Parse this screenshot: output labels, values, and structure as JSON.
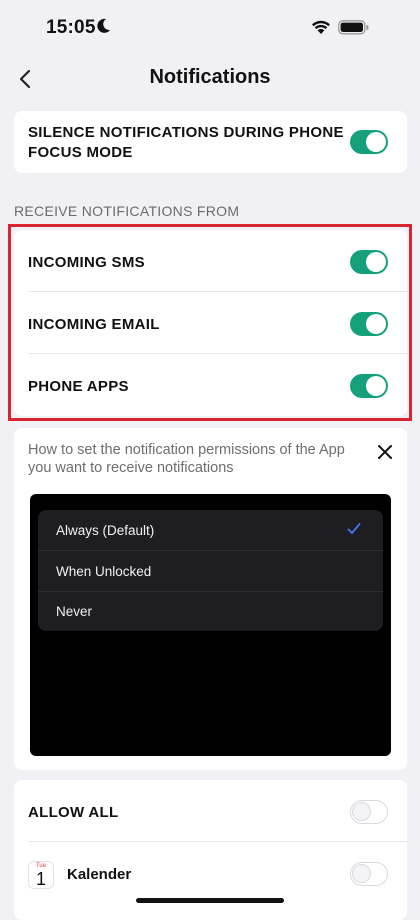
{
  "status_bar": {
    "time": "15:05",
    "icons": [
      "moon-icon",
      "wifi-icon",
      "battery-icon"
    ]
  },
  "nav": {
    "title": "Notifications",
    "back_icon": "chevron-left-icon"
  },
  "focus": {
    "label_line1": "SILENCE NOTIFICATIONS DURING PHONE",
    "label_line2": "FOCUS MODE",
    "enabled": true
  },
  "receive": {
    "header": "RECEIVE NOTIFICATIONS FROM",
    "items": [
      {
        "label": "INCOMING SMS",
        "enabled": true
      },
      {
        "label": "INCOMING EMAIL",
        "enabled": true
      },
      {
        "label": "PHONE APPS",
        "enabled": true
      }
    ]
  },
  "help": {
    "text": "How to set the notification permissions of the App you want to receive notifications",
    "options": [
      {
        "label": "Always (Default)",
        "selected": true
      },
      {
        "label": "When Unlocked",
        "selected": false
      },
      {
        "label": "Never",
        "selected": false
      }
    ]
  },
  "apps": {
    "allow_all": {
      "label": "ALLOW ALL",
      "enabled": false
    },
    "items": [
      {
        "label": "Kalender",
        "icon_day": "Tue",
        "icon_num": "1",
        "enabled": false
      }
    ]
  },
  "colors": {
    "accent": "#14a07b",
    "highlight": "#d7262f",
    "check": "#3a7bf5"
  }
}
